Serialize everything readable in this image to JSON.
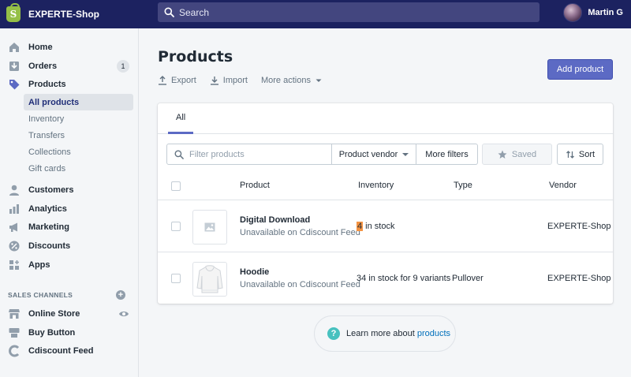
{
  "topbar": {
    "logo_letter": "S",
    "shop_name": "EXPERTE-Shop",
    "search_placeholder": "Search",
    "user_name": "Martin G"
  },
  "sidebar": {
    "items": [
      {
        "label": "Home",
        "icon": "home-icon"
      },
      {
        "label": "Orders",
        "icon": "orders-icon",
        "badge": "1"
      },
      {
        "label": "Products",
        "icon": "tag-icon"
      },
      {
        "label": "Customers",
        "icon": "customers-icon"
      },
      {
        "label": "Analytics",
        "icon": "analytics-icon"
      },
      {
        "label": "Marketing",
        "icon": "megaphone-icon"
      },
      {
        "label": "Discounts",
        "icon": "discount-icon"
      },
      {
        "label": "Apps",
        "icon": "apps-icon"
      }
    ],
    "products_sub": [
      "All products",
      "Inventory",
      "Transfers",
      "Collections",
      "Gift cards"
    ],
    "sales_channels_label": "SALES CHANNELS",
    "channels": [
      {
        "label": "Online Store",
        "icon": "store-icon"
      },
      {
        "label": "Buy Button",
        "icon": "buy-button-icon"
      },
      {
        "label": "Cdiscount Feed",
        "icon": "cdiscount-icon"
      }
    ]
  },
  "main": {
    "title": "Products",
    "actions": {
      "export": "Export",
      "import": "Import",
      "more": "More actions"
    },
    "add_button": "Add product",
    "tab_all": "All",
    "filter_placeholder": "Filter products",
    "vendor_filter": "Product vendor",
    "more_filters": "More filters",
    "saved": "Saved",
    "sort": "Sort",
    "columns": {
      "product": "Product",
      "inventory": "Inventory",
      "type": "Type",
      "vendor": "Vendor"
    },
    "rows": [
      {
        "name": "Digital Download",
        "status": "Unavailable on Cdiscount Feed",
        "inventory_count": "4",
        "inventory_text": " in stock",
        "type": "",
        "vendor": "EXPERTE-Shop"
      },
      {
        "name": "Hoodie",
        "status": "Unavailable on Cdiscount Feed",
        "inventory_text": "34 in stock for 9 variants",
        "type": "Pullover",
        "vendor": "EXPERTE-Shop"
      }
    ],
    "learn_prefix": "Learn more about",
    "learn_link": "products"
  },
  "colors": {
    "topbar": "#1c2260",
    "accent": "#5c6ac4",
    "stock_highlight": "#f49342",
    "help_icon": "#47c1bf"
  }
}
